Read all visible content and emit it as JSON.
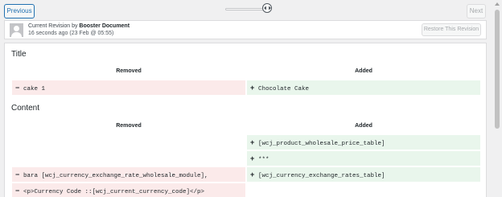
{
  "nav": {
    "previous_label": "Previous",
    "next_label": "Next"
  },
  "meta": {
    "revision_prefix": "Current Revision by ",
    "author": "Booster Document",
    "time": "16 seconds ago (23 Feb @ 05:55)",
    "restore_label": "Restore This Revision"
  },
  "title_section": {
    "heading": "Title",
    "removed_header": "Removed",
    "added_header": "Added",
    "removed_sign": "−",
    "added_sign": "+",
    "removed_text": "cake 1",
    "added_text": "Chocolate Cake"
  },
  "content_section": {
    "heading": "Content",
    "removed_header": "Removed",
    "added_header": "Added",
    "added_sign": "+",
    "removed_sign": "−",
    "added_1": "[wcj_product_wholesale_price_table]",
    "added_2": "***",
    "removed_3": "bara [wcj_currency_exchange_rate_wholesale_module],",
    "added_3": "[wcj_currency_exchange_rates_table]",
    "removed_4": "<p>Currency Code ::[wcj_current_currency_code]</p>"
  }
}
